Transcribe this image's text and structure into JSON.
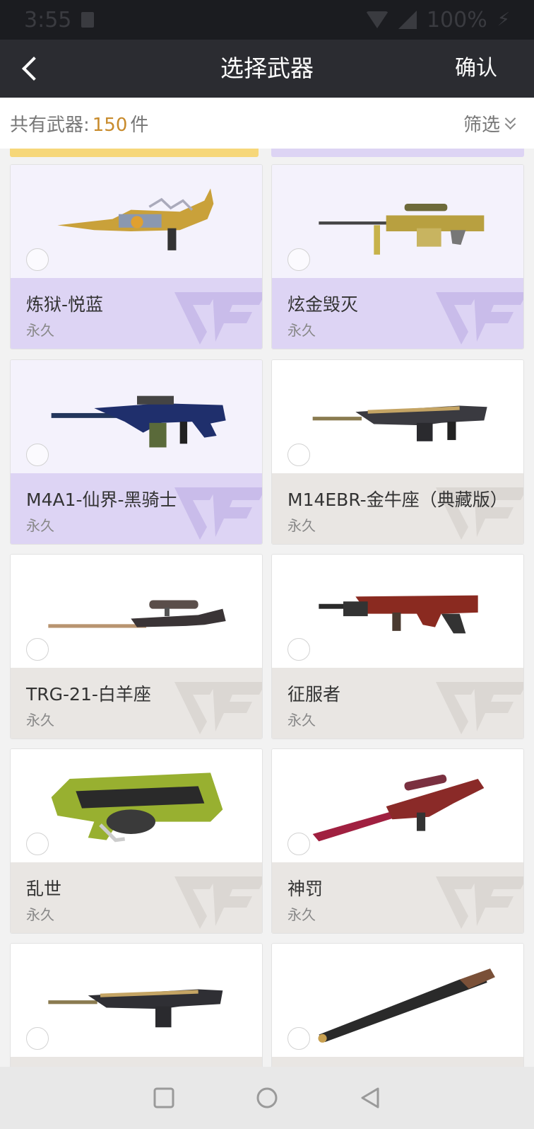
{
  "status_bar": {
    "time": "3:55",
    "battery": "100%"
  },
  "header": {
    "title": "选择武器",
    "confirm_label": "确认"
  },
  "summary": {
    "label": "共有武器:",
    "count": "150",
    "unit": "件",
    "filter_label": "筛选"
  },
  "colors": {
    "accent": "#c88b2c",
    "purple_footer": "#ddd4f4",
    "gray_footer": "#e9e6e3",
    "header_bg": "#2b2c31"
  },
  "weapons": [
    {
      "name": "炼狱-悦蓝",
      "duration": "永久",
      "theme": "purple",
      "icon": "dragon-rifle-icon"
    },
    {
      "name": "炫金毁灭",
      "duration": "永久",
      "theme": "purple",
      "icon": "gold-sniper-icon"
    },
    {
      "name": "M4A1-仙界-黑骑士",
      "duration": "永久",
      "theme": "purple",
      "icon": "m4a1-rifle-icon"
    },
    {
      "name": "M14EBR-金牛座（典藏版）",
      "duration": "永久",
      "theme": "gray",
      "icon": "m14ebr-rifle-icon"
    },
    {
      "name": "TRG-21-白羊座",
      "duration": "永久",
      "theme": "gray",
      "icon": "trg21-sniper-icon"
    },
    {
      "name": "征服者",
      "duration": "永久",
      "theme": "gray",
      "icon": "conqueror-rifle-icon"
    },
    {
      "name": "乱世",
      "duration": "永久",
      "theme": "gray",
      "icon": "p90-smg-icon"
    },
    {
      "name": "神罚",
      "duration": "永久",
      "theme": "gray",
      "icon": "red-sniper-icon"
    },
    {
      "name": "",
      "duration": "",
      "theme": "gray",
      "icon": "ebr-rifle-icon"
    },
    {
      "name": "",
      "duration": "",
      "theme": "gray",
      "icon": "shotgun-icon"
    }
  ]
}
